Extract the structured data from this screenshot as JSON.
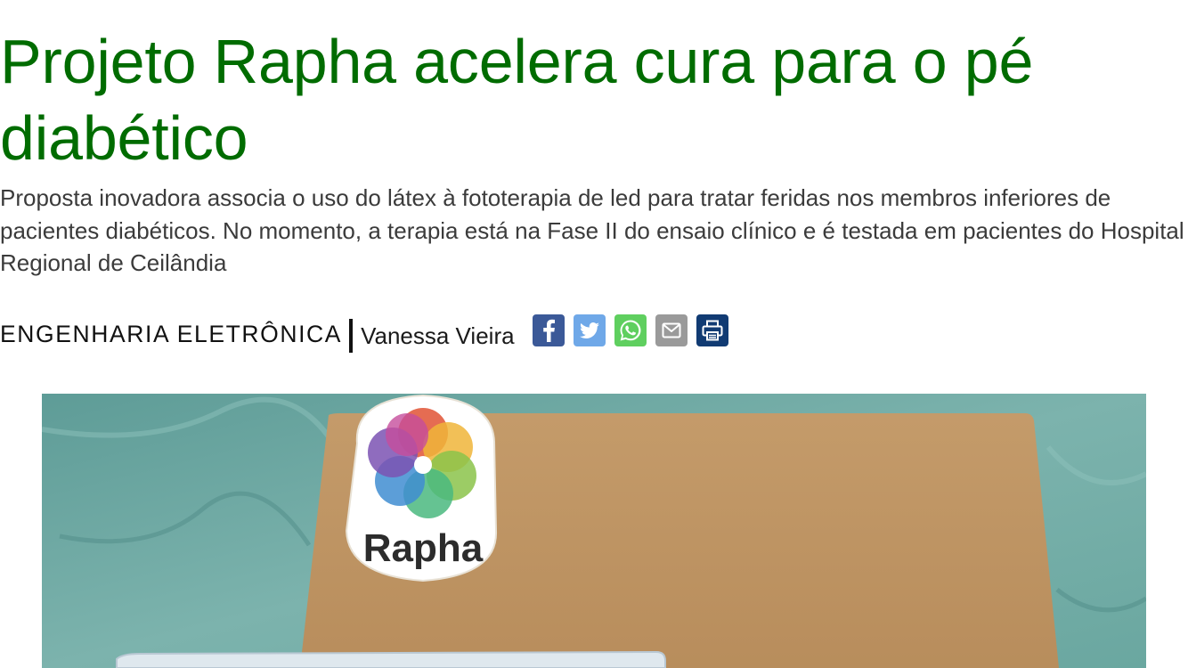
{
  "article": {
    "title": "Projeto Rapha acelera cura para o pé diabético",
    "subtitle": "Proposta inovadora associa o uso do látex à fototerapia de led para tratar feridas nos membros inferiores de pacientes diabéticos. No momento, a terapia está na Fase II do ensaio clínico e é testada em pacientes do Hospital Regional de Ceilândia",
    "category": "ENGENHARIA ELETRÔNICA",
    "author": "Vanessa Vieira"
  },
  "share": {
    "buttons": [
      {
        "name": "facebook",
        "icon": "facebook-icon",
        "color": "#3b5998"
      },
      {
        "name": "twitter",
        "icon": "twitter-icon",
        "color": "#6fa8e8"
      },
      {
        "name": "whatsapp",
        "icon": "whatsapp-icon",
        "color": "#5fcf5f"
      },
      {
        "name": "email",
        "icon": "email-icon",
        "color": "#9a9a9a"
      },
      {
        "name": "print",
        "icon": "print-icon",
        "color": "#113b73"
      }
    ]
  },
  "photo": {
    "logo_text": "Rapha"
  },
  "colors": {
    "headline": "#006c00",
    "body_text": "#3b3b3b"
  }
}
